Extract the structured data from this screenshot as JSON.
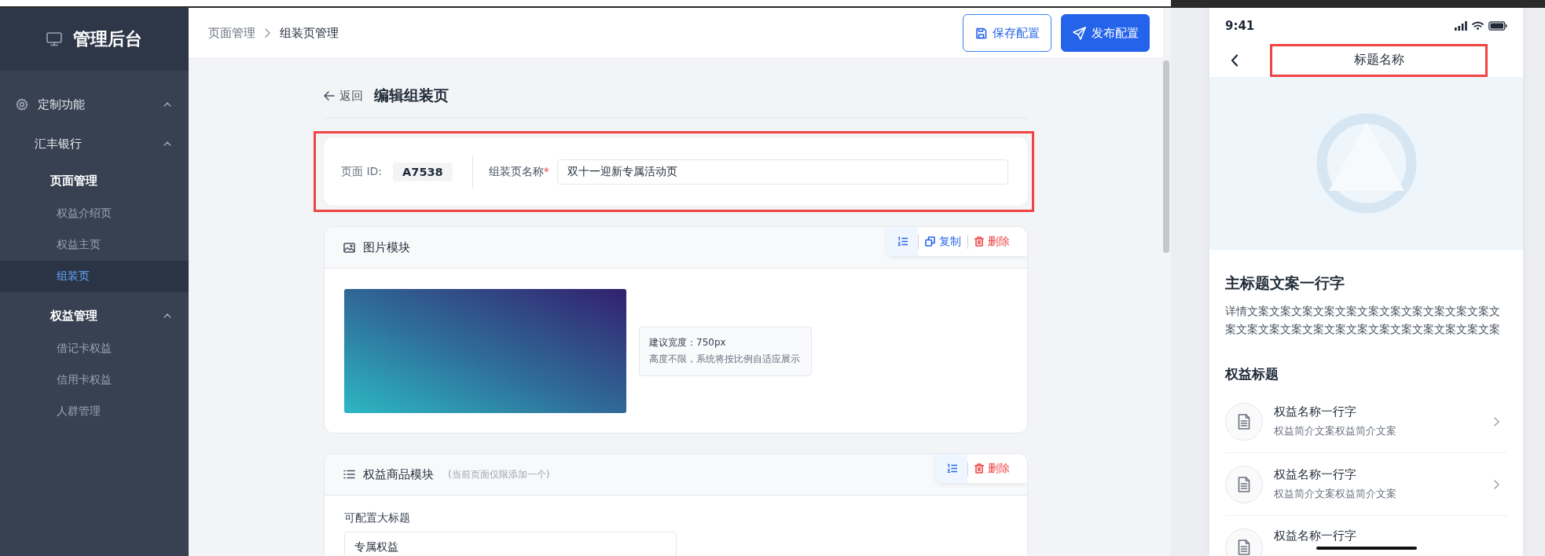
{
  "sidebar": {
    "title": "管理后台",
    "menu": [
      {
        "label": "定制功能",
        "expanded": true,
        "children": [
          {
            "label": "汇丰银行",
            "expanded": true,
            "children": [
              {
                "label": "页面管理",
                "children": [
                  {
                    "label": "权益介绍页",
                    "selected": false
                  },
                  {
                    "label": "权益主页",
                    "selected": false
                  },
                  {
                    "label": "组装页",
                    "selected": true
                  }
                ]
              },
              {
                "label": "权益管理",
                "expanded": true,
                "children": [
                  {
                    "label": "借记卡权益",
                    "selected": false
                  },
                  {
                    "label": "信用卡权益",
                    "selected": false
                  },
                  {
                    "label": "人群管理",
                    "selected": false
                  }
                ]
              }
            ]
          }
        ]
      }
    ]
  },
  "header": {
    "breadcrumb": [
      "页面管理",
      "组装页管理"
    ],
    "buttons": [
      {
        "kind": "outline",
        "label": "保存配置"
      },
      {
        "kind": "primary",
        "label": "发布配置"
      }
    ]
  },
  "editor": {
    "back": "返回",
    "title": "编辑组装页",
    "basic": {
      "highlighted": true,
      "id_label": "页面 ID:",
      "id_value": "A7538",
      "name_label": "组装页名称",
      "required_mark": "*",
      "name_value": "双十一迎新专属活动页"
    },
    "modules": [
      {
        "kind": "image",
        "title": "图片模块",
        "actions": [
          {
            "kind": "sort"
          },
          {
            "kind": "copy",
            "label": "复制"
          },
          {
            "kind": "delete",
            "label": "删除"
          }
        ],
        "hint_lines": [
          "建议宽度：750px",
          "高度不限，系统将按比例自适应展示"
        ]
      },
      {
        "kind": "benefits",
        "title": "权益商品模块",
        "note": "(当前页面仅限添加一个)",
        "actions": [
          {
            "kind": "sort"
          },
          {
            "kind": "delete",
            "label": "删除"
          }
        ],
        "field_label": "可配置大标题",
        "field_value": "专属权益"
      }
    ]
  },
  "phone": {
    "time": "9:41",
    "nav_title": "标题名称",
    "nav_highlighted": true,
    "heading": "主标题文案一行字",
    "description": "详情文案文案文案文案文案文案文案文案文案文案文案文案文案文案文案文案文案文案文案文案文案文案文案文案",
    "section_title": "权益标题",
    "items": [
      {
        "title": "权益名称一行字",
        "subtitle": "权益简介文案权益简介文案"
      },
      {
        "title": "权益名称一行字",
        "subtitle": "权益简介文案权益简介文案"
      },
      {
        "title": "权益名称一行字"
      }
    ]
  }
}
